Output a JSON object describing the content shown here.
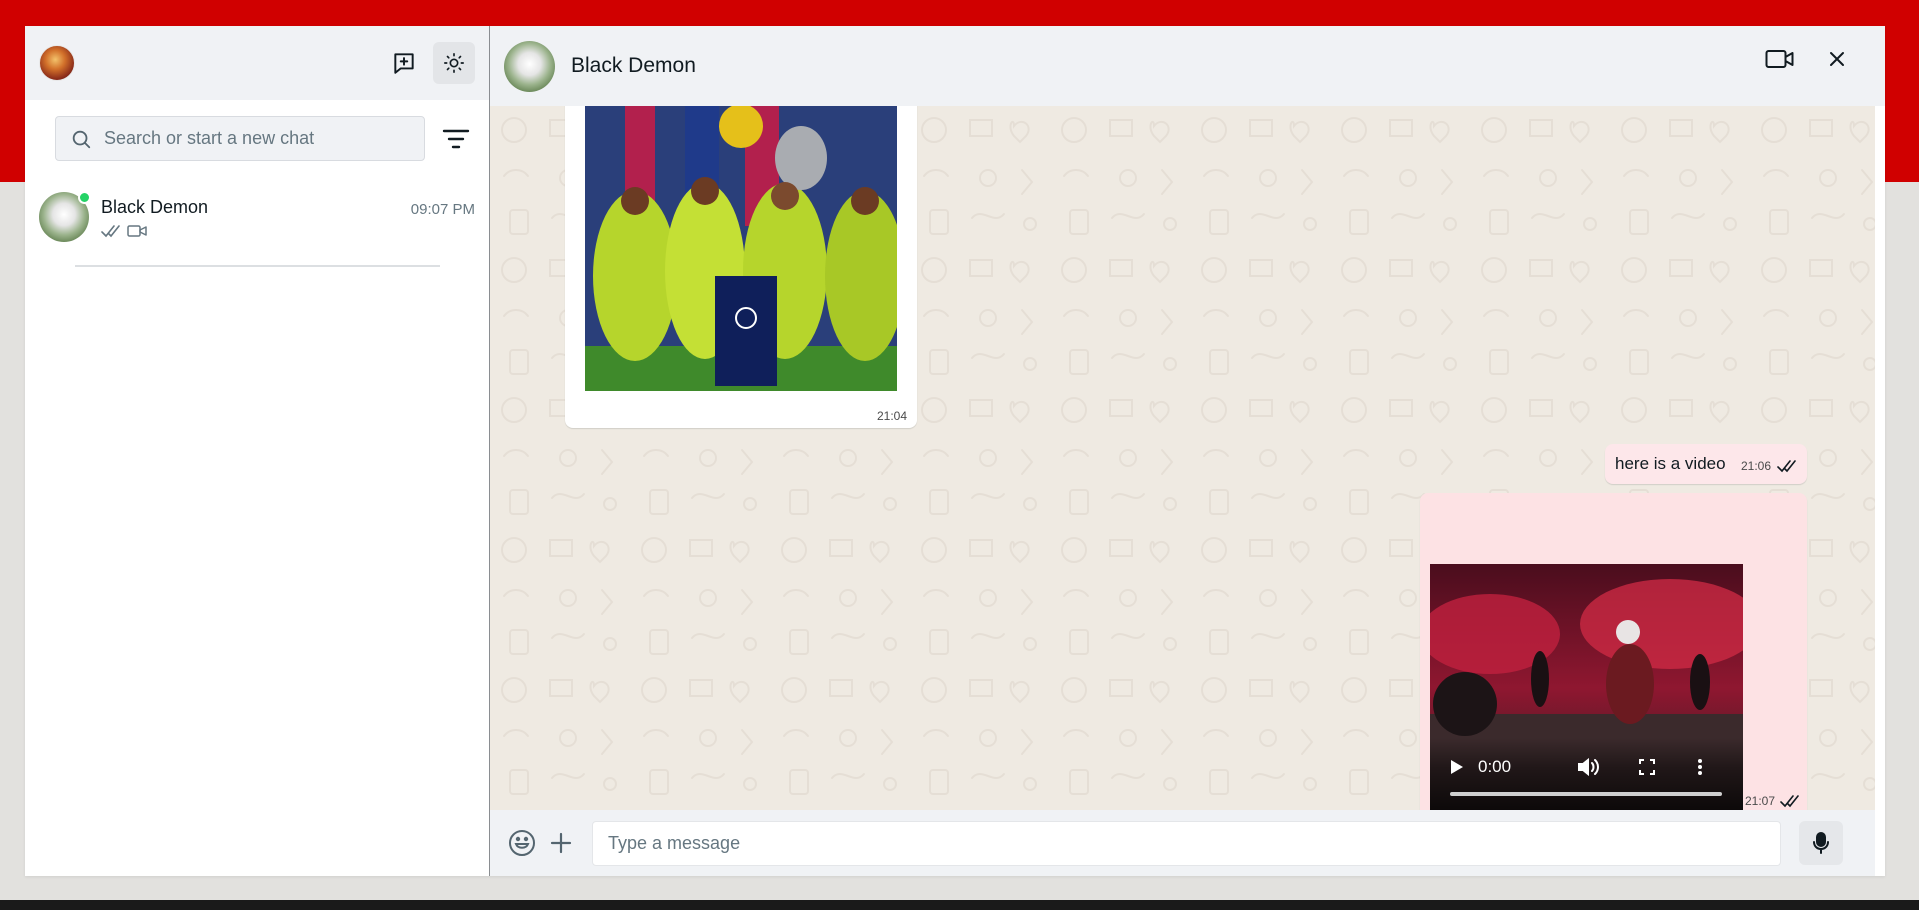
{
  "sidebar": {
    "search_placeholder": "Search or start a new chat",
    "chats": [
      {
        "name": "Black Demon",
        "time": "09:07 PM",
        "online": true,
        "last_message_type": "video",
        "read": true
      }
    ]
  },
  "conversation": {
    "contact_name": "Black Demon",
    "messages": [
      {
        "type": "image",
        "time": "21:04",
        "direction": "incoming"
      },
      {
        "type": "text",
        "text": "here is a video",
        "time": "21:06",
        "direction": "outgoing",
        "read": true
      },
      {
        "type": "video",
        "time": "21:07",
        "direction": "outgoing",
        "read": true,
        "current_time": "0:00"
      }
    ]
  },
  "composer": {
    "placeholder": "Type a message"
  },
  "icons": [
    "new-chat-icon",
    "theme-toggle-icon",
    "search-icon",
    "filter-icon",
    "video-call-icon",
    "close-icon",
    "emoji-icon",
    "plus-icon",
    "mic-icon",
    "double-check-icon",
    "video-camera-icon",
    "play-icon",
    "volume-icon",
    "fullscreen-icon",
    "more-vertical-icon"
  ],
  "colors": {
    "brand_band": "#d00000",
    "outgoing_bubble": "#fde7ea",
    "online": "#25d366",
    "chat_bg": "#efeae2"
  }
}
